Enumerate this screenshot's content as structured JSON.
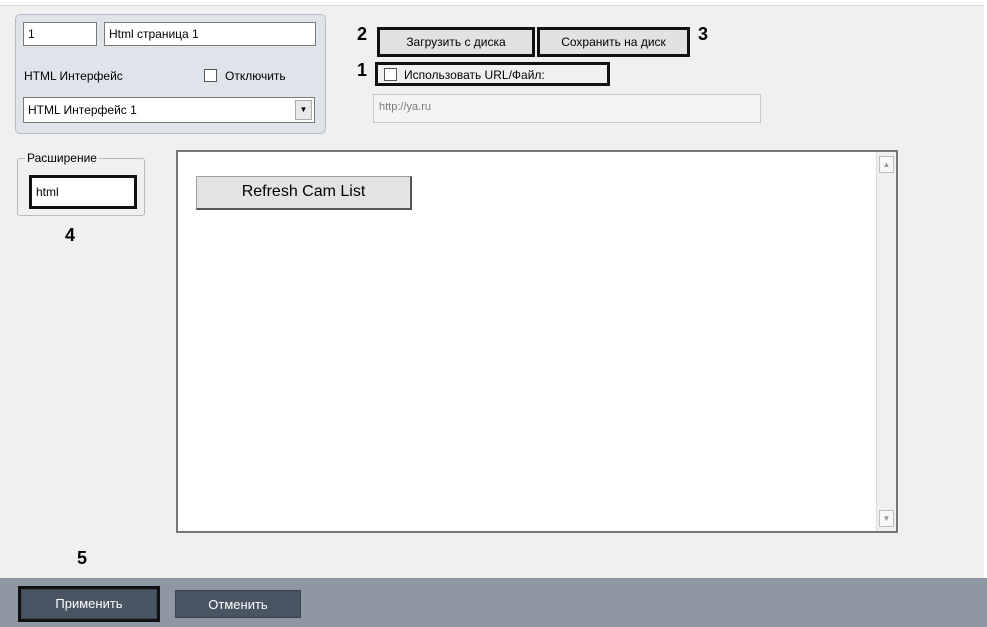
{
  "object": {
    "id": "1",
    "name": "Html страница 1",
    "interface_label": "HTML Интерфейс",
    "disable_label": "Отключить",
    "interface_select": "HTML Интерфейс 1"
  },
  "annotations": {
    "n1": "1",
    "n2": "2",
    "n3": "3",
    "n4": "4",
    "n5": "5"
  },
  "actions": {
    "load_label": "Загрузить с диска",
    "save_label": "Сохранить на диск",
    "use_url_label": "Использовать URL/Файл:",
    "url_value": "http://ya.ru"
  },
  "extension": {
    "legend": "Расширение",
    "value": "html"
  },
  "editor": {
    "refresh_label": "Refresh Cam List"
  },
  "footer": {
    "apply_label": "Применить",
    "cancel_label": "Отменить"
  },
  "colors": {
    "background": "#f0f0f0",
    "group_bg": "#dfe3ea",
    "bottom_bar": "#8e98a4",
    "button_dark": "#4a5563",
    "highlight": "#111111"
  },
  "icons": {
    "combo_arrow": "chevron-down-icon",
    "scroll_up": "chevron-up-icon",
    "scroll_down": "chevron-down-icon"
  }
}
